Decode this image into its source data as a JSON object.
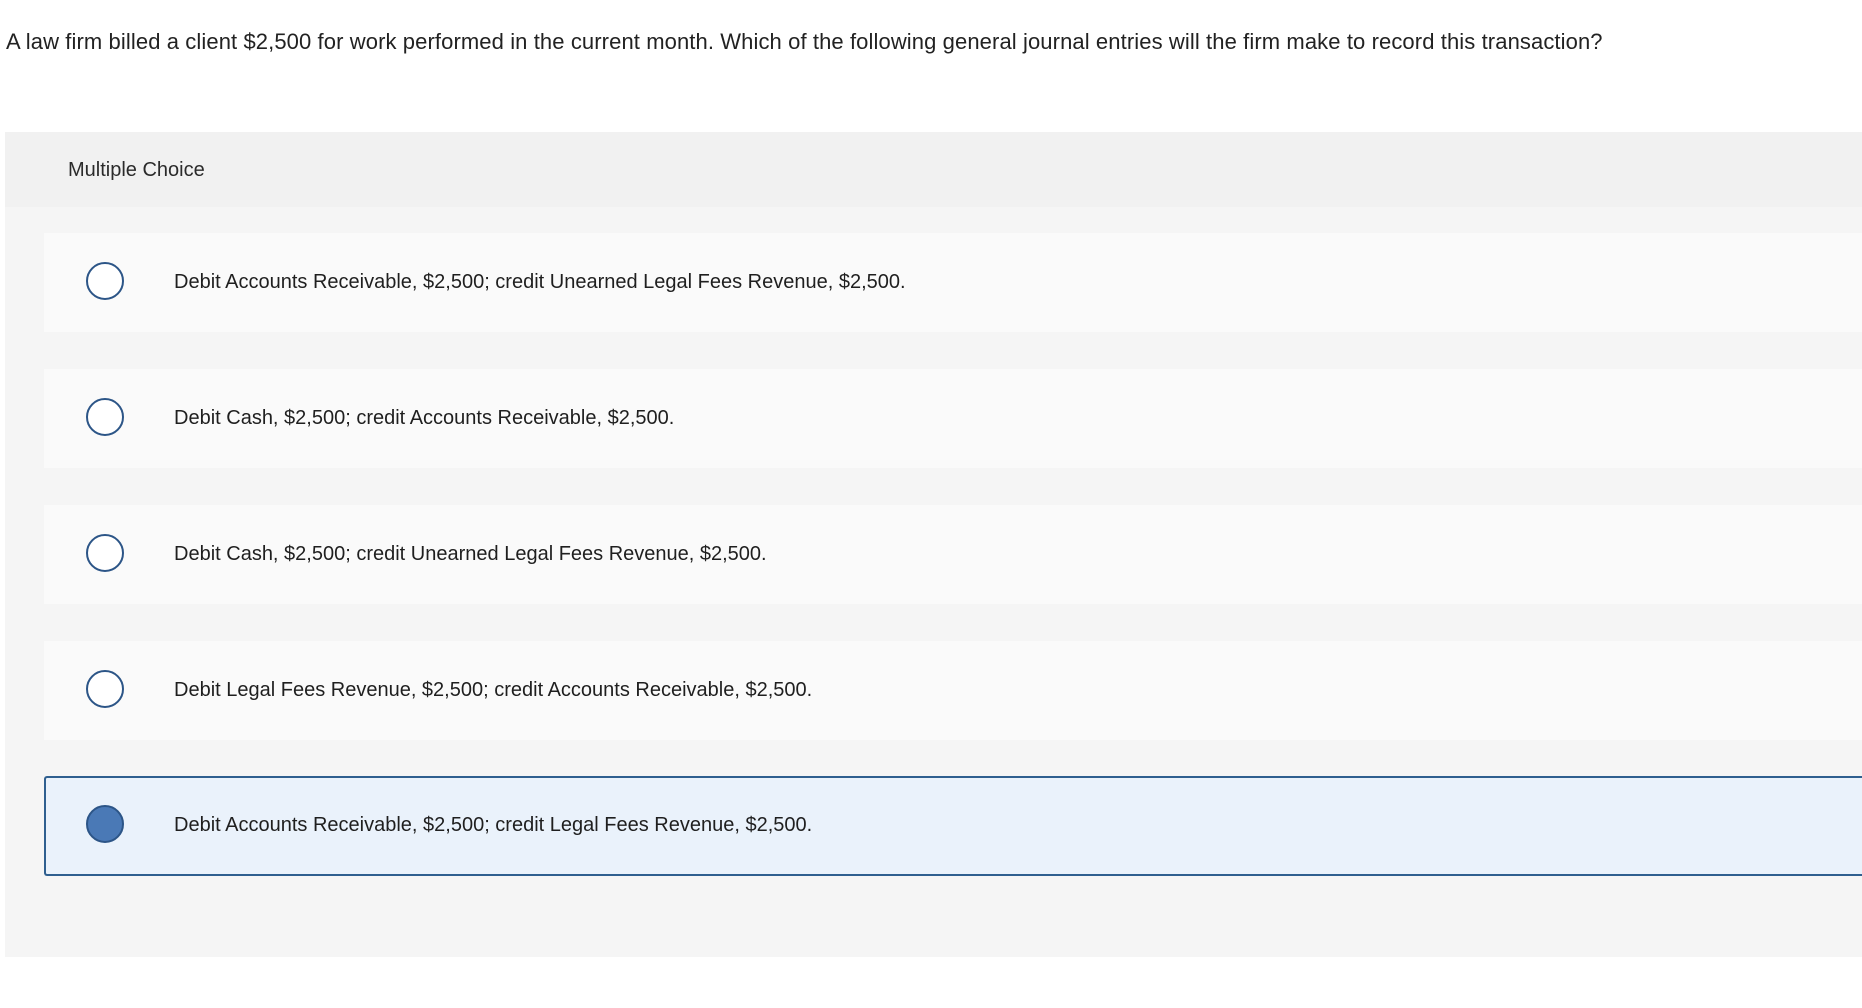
{
  "question": {
    "text": "A law firm billed a client $2,500 for work performed in the current month. Which of the following general journal entries will the firm make to record this transaction?"
  },
  "multiple_choice": {
    "header": "Multiple Choice",
    "options": [
      {
        "label": "Debit Accounts Receivable, $2,500; credit Unearned Legal Fees Revenue, $2,500.",
        "selected": false
      },
      {
        "label": "Debit Cash, $2,500; credit Accounts Receivable, $2,500.",
        "selected": false
      },
      {
        "label": "Debit Cash, $2,500; credit Unearned Legal Fees Revenue, $2,500.",
        "selected": false
      },
      {
        "label": "Debit Legal Fees Revenue, $2,500; credit Accounts Receivable, $2,500.",
        "selected": false
      },
      {
        "label": "Debit Accounts Receivable, $2,500; credit Legal Fees Revenue, $2,500.",
        "selected": true
      }
    ]
  },
  "colors": {
    "radio_border": "#2c5587",
    "radio_selected_fill": "#4a79b6",
    "selected_background": "#eaf2fb"
  }
}
